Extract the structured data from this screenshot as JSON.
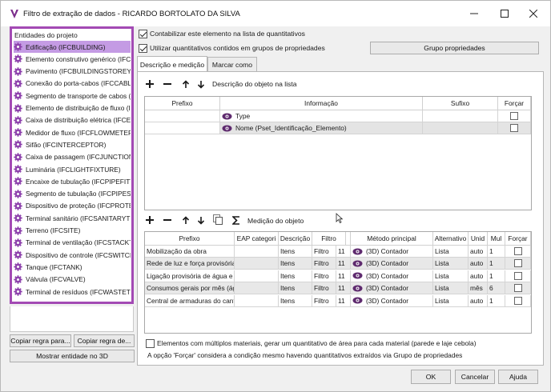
{
  "window": {
    "title": "Filtro de extração de dados - RICARDO BORTOLATO DA SILVA"
  },
  "left_panel": {
    "header": "Entidades do projeto",
    "selected_index": 0,
    "items": [
      "Edificação (IFCBUILDING)",
      "Elemento construtivo genérico (IFCB",
      "Pavimento (IFCBUILDINGSTOREY)",
      "Conexão do porta-cabos (IFCCABLEC",
      "Segmento de transporte de cabos (I",
      "Elemento de distribuição de fluxo (IF",
      "Caixa de distribuição elétrica (IFCEL",
      "Medidor de fluxo (IFCFLOWMETER)",
      "Sifão (IFCINTERCEPTOR)",
      "Caixa de passagem (IFCJUNCTIONBO",
      "Luminária (IFCLIGHTFIXTURE)",
      "Encaixe de tubulação (IFCPIPEFITTIN",
      "Segmento de tubulação (IFCPIPESEG",
      "Dispositivo de proteção (IFCPROTEC",
      "Terminal sanitário (IFCSANITARYTERI",
      "Terreno (IFCSITE)",
      "Terminal de ventilação (IFCSTACKTEF",
      "Dispositivo de controle (IFCSWITCHI",
      "Tanque (IFCTANK)",
      "Válvula (IFCVALVE)",
      "Terminal de resíduos (IFCWASTETERI"
    ],
    "copy_rule_button": "Copiar regra para...",
    "copy_rule_from_button": "Copiar regra de...",
    "show_3d_button": "Mostrar entidade no 3D"
  },
  "options": {
    "count_element_label": "Contabilizar este elemento na lista de quantitativos",
    "count_element_checked": true,
    "use_property_groups_label": "Utilizar quantitativos contidos em grupos de propriedades",
    "use_property_groups_checked": true,
    "property_group_button": "Grupo propriedades"
  },
  "tabs": [
    {
      "label": "Descrição e medição",
      "active": true
    },
    {
      "label": "Marcar como",
      "active": false
    }
  ],
  "description_section": {
    "toolbar_label": "Descrição do objeto na lista",
    "columns": [
      "Prefixo",
      "Informação",
      "Sufixo",
      "Forçar"
    ],
    "rows": [
      {
        "prefix": "",
        "info": "Type",
        "suffix": "",
        "force": false
      },
      {
        "prefix": "",
        "info": "Nome (Pset_Identificação_Elemento)",
        "suffix": "",
        "force": false
      }
    ]
  },
  "measurement_section": {
    "toolbar_label": "Medição do objeto",
    "columns": [
      "Prefixo",
      "EAP categori",
      "Descrição",
      "Filtro",
      "",
      "Método principal",
      "Alternativo",
      "Unid",
      "Mul",
      "Forçar"
    ],
    "rows": [
      {
        "prefix": "Mobilização da obra",
        "eap": "",
        "desc": "Itens",
        "filter": "Filtro",
        "filter_n": "11",
        "method": "(3D) Contador",
        "alt": "Lista",
        "unit": "auto",
        "mult": "1",
        "force": false
      },
      {
        "prefix": "Rede de luz e força provisórias",
        "eap": "",
        "desc": "Itens",
        "filter": "Filtro",
        "filter_n": "11",
        "method": "(3D) Contador",
        "alt": "Lista",
        "unit": "auto",
        "mult": "1",
        "force": false
      },
      {
        "prefix": "Ligação provisória de água e e",
        "eap": "",
        "desc": "Itens",
        "filter": "Filtro",
        "filter_n": "11",
        "method": "(3D) Contador",
        "alt": "Lista",
        "unit": "auto",
        "mult": "1",
        "force": false
      },
      {
        "prefix": "Consumos gerais por mês (ágı",
        "eap": "",
        "desc": "Itens",
        "filter": "Filtro",
        "filter_n": "11",
        "method": "(3D) Contador",
        "alt": "Lista",
        "unit": "mês",
        "mult": "6",
        "force": false
      },
      {
        "prefix": "Central de armaduras do cant",
        "eap": "",
        "desc": "Itens",
        "filter": "Filtro",
        "filter_n": "11",
        "method": "(3D) Contador",
        "alt": "Lista",
        "unit": "auto",
        "mult": "1",
        "force": false
      }
    ]
  },
  "footer": {
    "multi_material_label": "Elementos com múltiplos materiais, gerar um quantitativo de área para cada material (parede e laje cebola)",
    "multi_material_checked": false,
    "force_note": "A opção 'Forçar' considera a condição mesmo havendo quantitativos extraídos via Grupo de propriedades",
    "ok_button": "OK",
    "cancel_button": "Cancelar",
    "help_button": "Ajuda"
  },
  "colors": {
    "accent": "#a34ab4",
    "selected_row": "#c49be4",
    "eye_icon": "#5e2a6e",
    "gear_icon": "#8e44ad"
  }
}
